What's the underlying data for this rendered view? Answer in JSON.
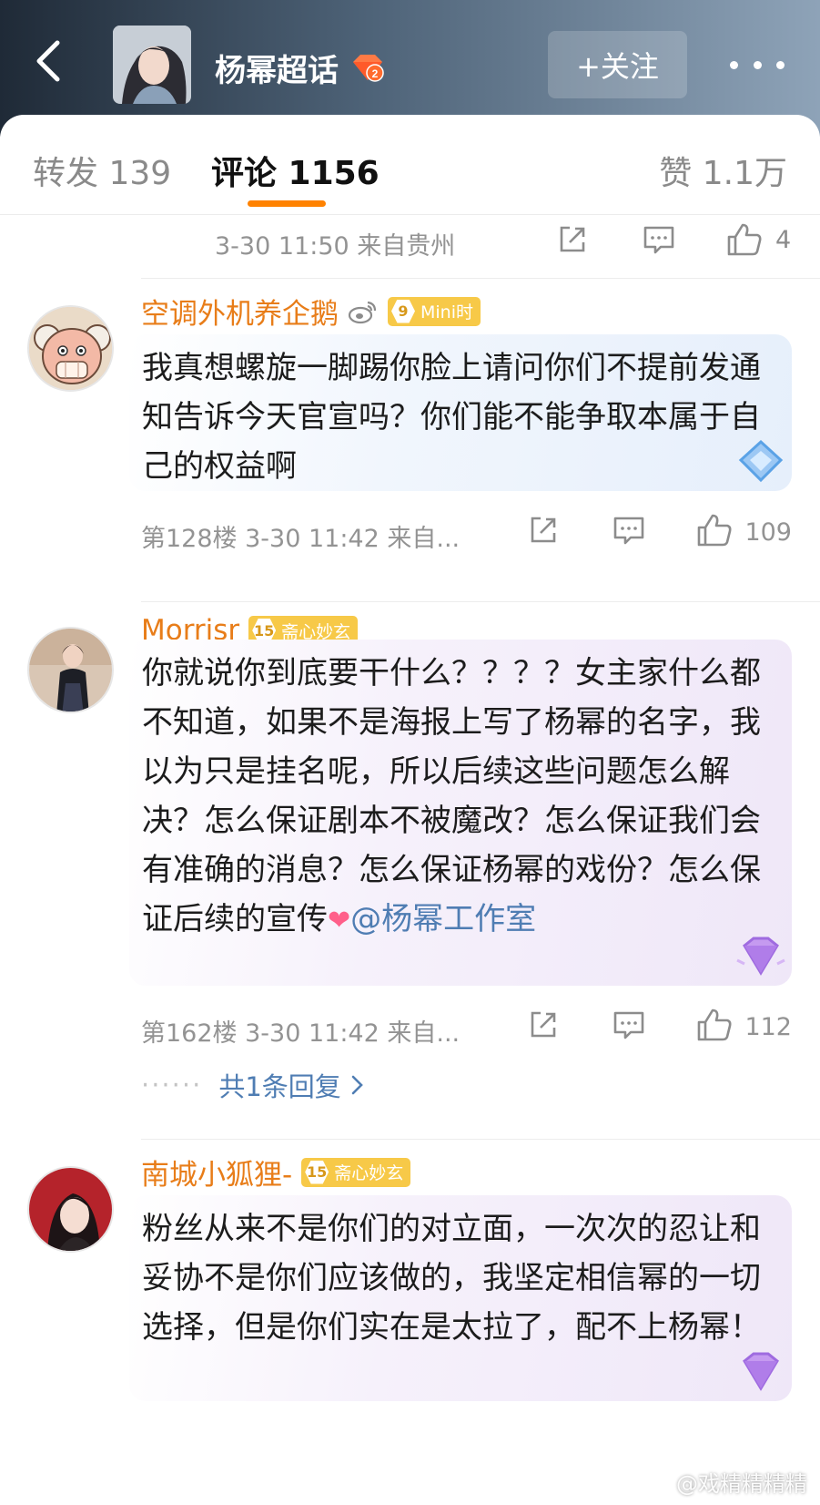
{
  "header": {
    "title": "杨幂超话",
    "level": "2",
    "follow_label": "+关注"
  },
  "tabs": {
    "forward": "转发 139",
    "comment": "评论 1156",
    "like": "赞 1.1万"
  },
  "top_meta": {
    "time_location": "3-30 11:50 来自贵州",
    "like_count": "4"
  },
  "comments": [
    {
      "username": "空调外机养企鹅",
      "badge_level": "9",
      "badge_text": "Mini时",
      "text": "我真想螺旋一脚踢你脸上请问你们不提前发通知告诉今天官宣吗？你们能不能争取本属于自己的权益啊",
      "meta": "第128楼 3-30 11:42 来自...",
      "like_count": "109"
    },
    {
      "username": "Morrisr",
      "badge_level": "15",
      "badge_text": "斋心妙玄",
      "text": "你就说你到底要干什么？？？？女主家什么都不知道，如果不是海报上写了杨幂的名字，我以为只是挂名呢，所以后续这些问题怎么解决？怎么保证剧本不被魔改？怎么保证我们会有准确的消息？怎么保证杨幂的戏份？怎么保证后续的宣传",
      "mention": "@杨幂工作室",
      "meta": "第162楼 3-30 11:42 来自...",
      "like_count": "112",
      "replies": "共1条回复"
    },
    {
      "username": "南城小狐狸-",
      "badge_level": "15",
      "badge_text": "斋心妙玄",
      "text": "粉丝从来不是你们的对立面，一次次的忍让和妥协不是你们应该做的，我坚定相信幂的一切选择，但是你们实在是太拉了，配不上杨幂！"
    }
  ],
  "watermark": "@戏精精精精",
  "colors": {
    "accent": "#ff8200",
    "username": "#e87d19",
    "mention": "#4f7db3",
    "meta": "#939393"
  },
  "icons": [
    "back-icon",
    "more-icon",
    "share-icon",
    "comment-icon",
    "like-icon",
    "weibo-icon",
    "gem-icon",
    "chevron-right-icon"
  ]
}
